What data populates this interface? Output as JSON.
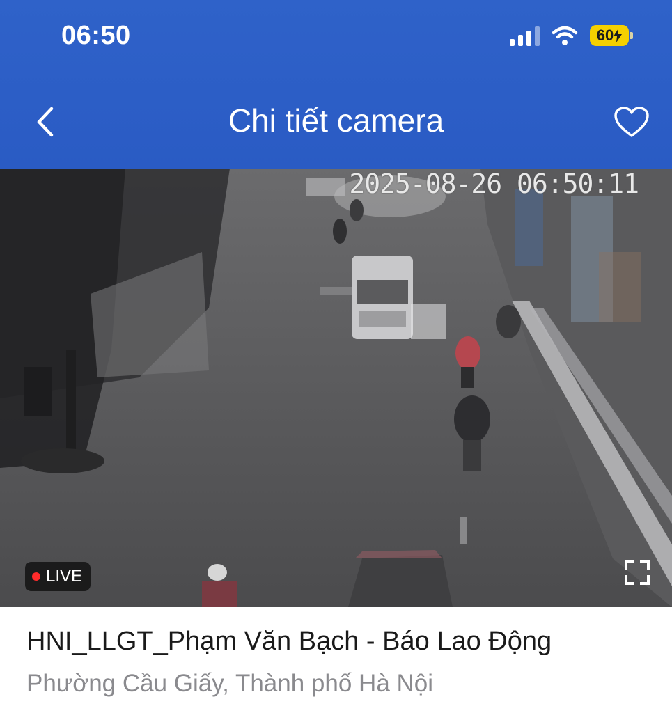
{
  "status_bar": {
    "time": "06:50",
    "battery": "60",
    "battery_color": "#f5d000"
  },
  "nav": {
    "title": "Chi tiết camera",
    "back_icon": "chevron-left-icon",
    "favorite_icon": "heart-icon"
  },
  "video": {
    "timestamp": "2025-08-26 06:50:11",
    "live_label": "LIVE",
    "live_color": "#ff2b2b",
    "fullscreen_icon": "fullscreen-icon"
  },
  "camera": {
    "name": "HNI_LLGT_Phạm Văn Bạch - Báo Lao Động",
    "location": "Phường Cầu Giấy, Thành phố Hà Nội"
  },
  "colors": {
    "header": "#2f62c9"
  }
}
